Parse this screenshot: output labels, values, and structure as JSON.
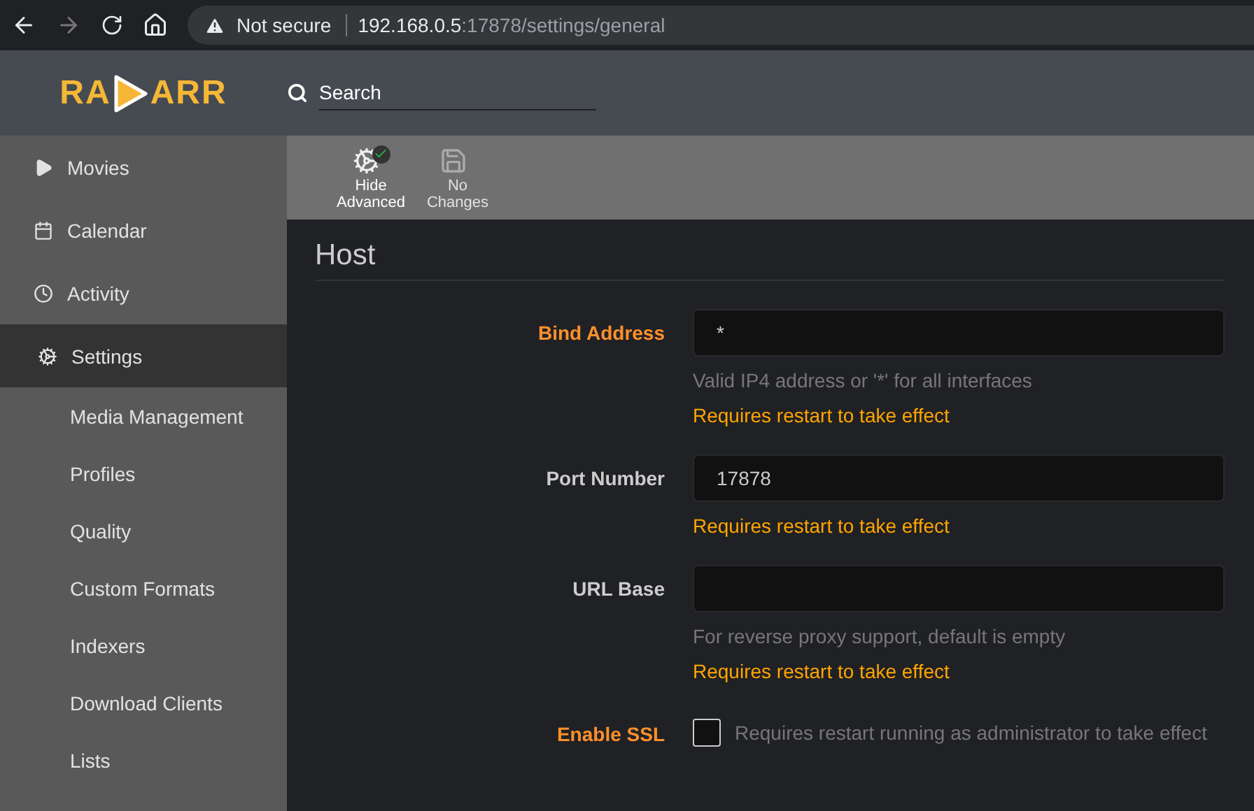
{
  "browser": {
    "warning": "Not secure",
    "url_host": "192.168.0.5",
    "url_path": ":17878/settings/general"
  },
  "logo": {
    "left": "RA",
    "right": "ARR"
  },
  "search": {
    "placeholder": "Search"
  },
  "sidebar": {
    "items": [
      {
        "label": "Movies",
        "kind": "play",
        "selected": false
      },
      {
        "label": "Calendar",
        "kind": "calendar",
        "selected": false
      },
      {
        "label": "Activity",
        "kind": "clock",
        "selected": false
      },
      {
        "label": "Settings",
        "kind": "gears",
        "selected": true,
        "children": [
          {
            "label": "Media Management"
          },
          {
            "label": "Profiles"
          },
          {
            "label": "Quality"
          },
          {
            "label": "Custom Formats"
          },
          {
            "label": "Indexers"
          },
          {
            "label": "Download Clients"
          },
          {
            "label": "Lists"
          }
        ]
      }
    ]
  },
  "toolbar": [
    {
      "kind": "advanced",
      "label": "Hide",
      "label2": "Advanced",
      "disabled": false
    },
    {
      "kind": "save",
      "label": "No",
      "label2": "Changes",
      "disabled": true
    }
  ],
  "section": {
    "title": "Host"
  },
  "fields": [
    {
      "kind": "text",
      "label": "Bind Address",
      "advanced": true,
      "value": "*",
      "help": "Valid IP4 address or '*' for all interfaces",
      "warning": "Requires restart to take effect"
    },
    {
      "kind": "text",
      "label": "Port Number",
      "advanced": false,
      "value": "17878",
      "warning": "Requires restart to take effect"
    },
    {
      "kind": "text",
      "label": "URL Base",
      "advanced": false,
      "help": "For reverse proxy support, default is empty",
      "warning": "Requires restart to take effect"
    },
    {
      "kind": "checkbox",
      "label": "Enable SSL",
      "advanced": true,
      "checked": false,
      "help": "Requires restart running as administrator to take effect"
    }
  ]
}
